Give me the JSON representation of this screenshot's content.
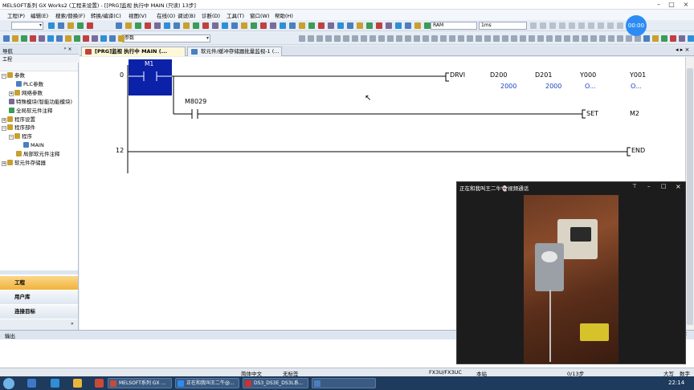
{
  "window": {
    "title": "MELSOFT系列 GX Works2 (工程未设置) - [[PRG]监视 执行中 MAIN (只读) 13步]"
  },
  "menu": [
    "工程(P)",
    "编辑(E)",
    "搜索/替换(F)",
    "转换/编译(C)",
    "视图(V)",
    "在线(O)",
    "调试(B)",
    "诊断(D)",
    "工具(T)",
    "窗口(W)",
    "帮助(H)"
  ],
  "toolbar": {
    "search_combo": "参数",
    "memory_combo": "RAM",
    "scan_combo": "1ms"
  },
  "timer": "00:00",
  "nav": {
    "title": "导航",
    "pin": "ᵖ ×",
    "section": "工程",
    "tree": [
      {
        "label": "参数",
        "indent": 0,
        "pm": "−",
        "color": "#c8a030"
      },
      {
        "label": "PLC参数",
        "indent": 1,
        "pm": "",
        "color": "#4a7fc0"
      },
      {
        "label": "网络参数",
        "indent": 1,
        "pm": "+",
        "color": "#c8a030"
      },
      {
        "label": "特殊模块(智能功能模块)",
        "indent": 0,
        "pm": "",
        "color": "#7a6a9a"
      },
      {
        "label": "全局软元件注释",
        "indent": 0,
        "pm": "",
        "color": "#3c9a5a"
      },
      {
        "label": "程序设置",
        "indent": 0,
        "pm": "+",
        "color": "#c8a030"
      },
      {
        "label": "程序部件",
        "indent": 0,
        "pm": "−",
        "color": "#c8a030"
      },
      {
        "label": "程序",
        "indent": 1,
        "pm": "−",
        "color": "#c8a030"
      },
      {
        "label": "MAIN",
        "indent": 2,
        "pm": "",
        "color": "#4a7fc0"
      },
      {
        "label": "局部软元件注释",
        "indent": 1,
        "pm": "",
        "color": "#c8a030"
      },
      {
        "label": "软元件存储器",
        "indent": 0,
        "pm": "+",
        "color": "#c8a030"
      }
    ],
    "bottom_buttons": [
      "工程",
      "用户库",
      "连接目标"
    ]
  },
  "tabs": [
    {
      "label": "[PRG]监视 执行中 MAIN (..."
    },
    {
      "label": "软元件/缓冲存储器批量监视-1 (..."
    }
  ],
  "ladder": {
    "rows": [
      {
        "step": "0",
        "contact": "M1",
        "instr": "DRVI",
        "operands": [
          "D200",
          "D201",
          "Y000",
          "Y001"
        ],
        "values": [
          "2000",
          "2000",
          "O...",
          "O..."
        ]
      },
      {
        "contact": "M8029",
        "instr": "SET",
        "operands": [
          "M2"
        ]
      },
      {
        "step": "12",
        "instr": "END"
      }
    ]
  },
  "video_call": {
    "title": "正在和我叫王二牛👻视频通话"
  },
  "output": {
    "title": "输出",
    "pin": "ᵖ ×"
  },
  "status": {
    "lang": "简体中文",
    "label": "无标签",
    "cpu": "FX3U/FX3UC",
    "station": "本站",
    "steps": "0/13步",
    "caps": "大写",
    "num": "数字"
  },
  "taskbar": {
    "tasks": [
      "MELSOFT系列 GX ...",
      "正在和我叫王二牛@...",
      "DS3_DS3E_DS3L系...",
      ""
    ],
    "time": "22:14"
  }
}
